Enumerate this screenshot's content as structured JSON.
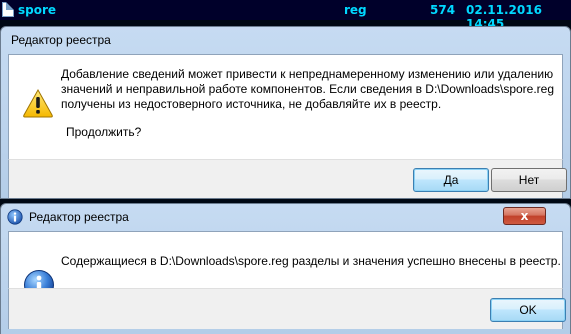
{
  "topbar": {
    "filename": "spore",
    "extension": "reg",
    "size": "574",
    "datetime": "02.11.2016 14:45"
  },
  "dialog_confirm": {
    "title": "Редактор реестра",
    "icon": "warning-icon",
    "message_line1": "Добавление сведений может привести к непреднамеренному изменению или удалению",
    "message_line2": "значений и неправильной работе компонентов. Если сведения в D:\\Downloads\\spore.reg",
    "message_line3": "получены из недостоверного источника, не добавляйте их в реестр.",
    "question": "Продолжить?",
    "yes_label": "Да",
    "no_label": "Нет"
  },
  "dialog_info": {
    "title": "Редактор реестра",
    "icon": "info-icon",
    "message": "Содержащиеся в D:\\Downloads\\spore.reg разделы и значения успешно внесены в реестр.",
    "ok_label": "OK",
    "close_label": "x"
  },
  "colors": {
    "topbar_bg": "#00002a",
    "topbar_text": "#00d8ff",
    "dialog_frame": "#c6dbf2",
    "close_button": "#c1402a"
  }
}
